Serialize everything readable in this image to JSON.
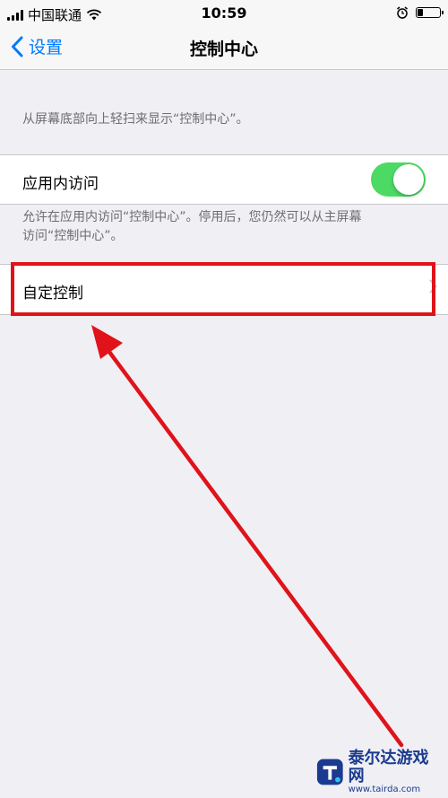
{
  "status_bar": {
    "carrier": "中国联通",
    "time": "10:59",
    "battery_level": 0.25
  },
  "nav": {
    "back_label": "设置",
    "title": "控制中心"
  },
  "description": "从屏幕底部向上轻扫来显示“控制中心”。",
  "access_within_apps": {
    "label": "应用内访问",
    "enabled": true,
    "footer_line1": "允许在应用内访问“控制中心”。停用后，您仍然可以从主屏幕",
    "footer_line2": "访问“控制中心”。"
  },
  "customize": {
    "label": "自定控制"
  },
  "colors": {
    "toggle_on": "#4cd964",
    "accent": "#007aff",
    "highlight": "#e0131a"
  },
  "watermark": {
    "title": "泰尔达游戏网",
    "url": "www.tairda.com"
  }
}
